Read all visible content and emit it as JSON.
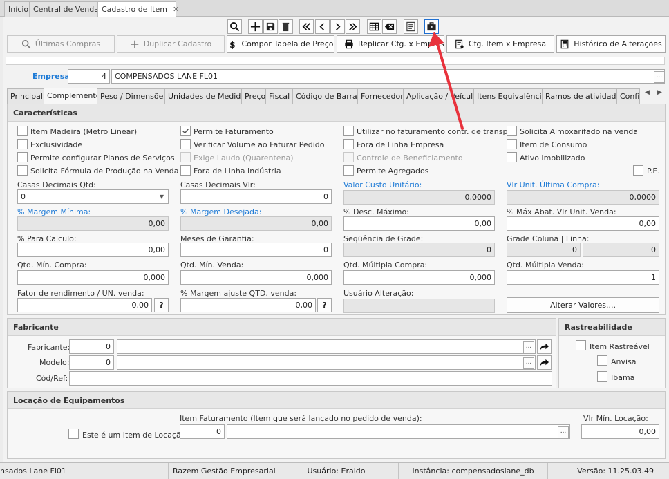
{
  "window_tabs": {
    "inicio": "Início",
    "central": "Central de Vendas",
    "cadastro": "Cadastro de Item",
    "close": "✕"
  },
  "actions": {
    "ultimas_compras": "Últimas Compras",
    "duplicar": "Duplicar Cadastro",
    "compor": "Compor Tabela de Preço",
    "replicar": "Replicar Cfg. x Empresa",
    "cfg_item": "Cfg. Item x  Empresa",
    "historico": "Histórico de Alterações"
  },
  "empresa": {
    "label": "Empresa:",
    "code": "4",
    "name": "COMPENSADOS LANE FL01",
    "dots": "..."
  },
  "tabs": [
    "Principal",
    "Complemento",
    "Peso / Dimensões",
    "Unidades de Medida",
    "Preço",
    "Fiscal",
    "Código de Barras",
    "Fornecedor",
    "Aplicação / Veículo",
    "Itens Equivalência",
    "Ramos de atividade",
    "Confi"
  ],
  "caracteristicas": {
    "title": "Características",
    "checks": {
      "item_madeira": "Item Madeira (Metro Linear)",
      "exclusividade": "Exclusividade",
      "planos_servicos": "Permite configurar Planos de Serviços",
      "formula_producao": "Solicita Fórmula de Produção na Venda",
      "permite_faturamento": "Permite Faturamento",
      "verificar_volume": "Verificar Volume ao Faturar Pedido",
      "exige_laudo": "Exige Laudo (Quarentena)",
      "fora_linha_industria": "Fora de Linha Indústria",
      "utilizar_faturamento": "Utilizar no faturamento contr. de transp.",
      "fora_linha_empresa": "Fora de Linha Empresa",
      "controle_beneficiamento": "Controle de Beneficiamento",
      "permite_agregados": "Permite Agregados",
      "solicita_almox": "Solicita Almoxarifado na venda",
      "item_consumo": "Item de Consumo",
      "ativo_imobilizado": "Ativo Imobilizado",
      "pe": "P.E."
    },
    "fields": {
      "casas_qtd_label": "Casas Decimais Qtd:",
      "casas_qtd_value": "0",
      "casas_vlr_label": "Casas Decimais Vlr:",
      "casas_vlr_value": "0",
      "valor_custo_label": "Valor Custo Unitário:",
      "valor_custo_value": "0,0000",
      "vlr_ultima_label": "Vlr Unit. Última Compra:",
      "vlr_ultima_value": "0,0000",
      "margem_min_label": "% Margem Mínima:",
      "margem_min_value": "0,00",
      "margem_des_label": "% Margem Desejada:",
      "margem_des_value": "0,00",
      "desc_max_label": "% Desc. Máximo:",
      "desc_max_value": "0,00",
      "max_abat_label": "% Máx Abat. Vlr Unit. Venda:",
      "max_abat_value": "0,00",
      "para_calc_label": "% Para Calculo:",
      "para_calc_value": "0,00",
      "meses_gar_label": "Meses de Garantia:",
      "meses_gar_value": "0",
      "seq_grade_label": "Seqüência de Grade:",
      "seq_grade_value": "0",
      "grade_col_label": "Grade Coluna | Linha:",
      "grade_col_value": "0",
      "grade_lin_value": "0",
      "min_compra_label": "Qtd. Mín. Compra:",
      "min_compra_value": "0,000",
      "min_venda_label": "Qtd. Mín. Venda:",
      "min_venda_value": "0,000",
      "mult_compra_label": "Qtd. Múltipla Compra:",
      "mult_compra_value": "0,000",
      "mult_venda_label": "Qtd. Múltipla Venda:",
      "mult_venda_value": "1",
      "fator_label": "Fator de rendimento / UN. venda:",
      "fator_value": "0,00",
      "margem_ajuste_label": "% Margem ajuste QTD. venda:",
      "margem_ajuste_value": "0,00",
      "usuario_alt_label": "Usuário Alteração:",
      "usuario_alt_value": "",
      "alterar_valores": "Alterar Valores....",
      "help": "?"
    }
  },
  "fabricante": {
    "title": "Fabricante",
    "fabricante_label": "Fabricante:",
    "fabricante_code": "0",
    "modelo_label": "Modelo:",
    "modelo_code": "0",
    "codref_label": "Cód/Ref:",
    "dots": "..."
  },
  "rastreabilidade": {
    "title": "Rastreabilidade",
    "item_rastreavel": "Item Rastreável",
    "anvisa": "Anvisa",
    "ibama": "Ibama"
  },
  "locacao": {
    "title": "Locação de Equipamentos",
    "item_locacao": "Este é um Item de Locação",
    "item_fat_label": "Item Faturamento (Item que será lançado no pedido de venda):",
    "item_fat_code": "0",
    "vlr_min_label": "Vlr Mín. Locação:",
    "vlr_min_value": "0,00",
    "dots": "..."
  },
  "statusbar": {
    "empresa": "nsados Lane Fl01",
    "sistema": "Razem Gestão Empresarial",
    "usuario": "Usuário: Eraldo",
    "instancia": "Instância: compensadoslane_db",
    "versao": "Versão: 11.25.03.49"
  },
  "colors": {
    "accent_blue": "#1f7bd6",
    "annotation_arrow": "#e8323c"
  }
}
